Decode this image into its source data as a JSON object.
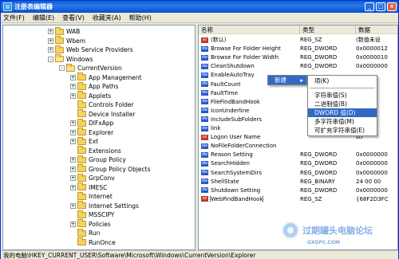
{
  "window": {
    "title": "注册表编辑器",
    "buttons": {
      "minimize": "_",
      "maximize": "□",
      "close": "×"
    }
  },
  "menu": [
    "文件(F)",
    "编辑(E)",
    "查看(V)",
    "收藏夹(A)",
    "帮助(H)"
  ],
  "tree": [
    {
      "label": "WAB",
      "expander": "+"
    },
    {
      "label": "Wbem",
      "expander": "+"
    },
    {
      "label": "Web Service Providers",
      "expander": "+"
    },
    {
      "label": "Windows",
      "expander": "-"
    },
    {
      "label": "CurrentVersion",
      "expander": "-"
    },
    {
      "label": "App Management",
      "expander": "+"
    },
    {
      "label": "App Paths",
      "expander": "+"
    },
    {
      "label": "Applets",
      "expander": "+"
    },
    {
      "label": "Controls Folder",
      "expander": ""
    },
    {
      "label": "Device Installer",
      "expander": ""
    },
    {
      "label": "DIFxApp",
      "expander": "+"
    },
    {
      "label": "Explorer",
      "expander": "+"
    },
    {
      "label": "Ext",
      "expander": "+"
    },
    {
      "label": "Extensions",
      "expander": ""
    },
    {
      "label": "Group Policy",
      "expander": "+"
    },
    {
      "label": "Group Policy Objects",
      "expander": "+"
    },
    {
      "label": "GrpConv",
      "expander": "+"
    },
    {
      "label": "IMESC",
      "expander": "+"
    },
    {
      "label": "Internet",
      "expander": ""
    },
    {
      "label": "Internet Settings",
      "expander": "+"
    },
    {
      "label": "MSSCIPY",
      "expander": ""
    },
    {
      "label": "Policies",
      "expander": "+"
    },
    {
      "label": "Run",
      "expander": ""
    },
    {
      "label": "RunOnce",
      "expander": ""
    }
  ],
  "columns": {
    "name": "名称",
    "type": "类型",
    "data": "数据"
  },
  "values": [
    {
      "icon": "sz",
      "name": "(默认)",
      "type": "REG_SZ",
      "data": "(数值未设"
    },
    {
      "icon": "dw",
      "name": "Browse For Folder Height",
      "type": "REG_DWORD",
      "data": "0x0000012"
    },
    {
      "icon": "dw",
      "name": "Browse For Folder Width",
      "type": "REG_DWORD",
      "data": "0x0000010"
    },
    {
      "icon": "dw",
      "name": "CleanShutdown",
      "type": "REG_DWORD",
      "data": "0x0000000"
    },
    {
      "icon": "dw",
      "name": "EnableAutoTray",
      "type": "",
      "data": ""
    },
    {
      "icon": "dw",
      "name": "FaultCount",
      "type": "",
      "data": ""
    },
    {
      "icon": "dw",
      "name": "FaultTime",
      "type": "",
      "data": ""
    },
    {
      "icon": "dw",
      "name": "FileFindBandHook",
      "type": "",
      "data": "A18"
    },
    {
      "icon": "dw",
      "name": "IconUnderline",
      "type": "",
      "data": ""
    },
    {
      "icon": "dw",
      "name": "IncludeSubFolders",
      "type": "",
      "data": ""
    },
    {
      "icon": "dw",
      "name": "link",
      "type": "",
      "data": ""
    },
    {
      "icon": "sz",
      "name": "Logon User Name",
      "type": "",
      "data": "str"
    },
    {
      "icon": "dw",
      "name": "NoFileFolderConnection",
      "type": "",
      "data": ""
    },
    {
      "icon": "dw",
      "name": "Reason Setting",
      "type": "REG_DWORD",
      "data": "0x0000000"
    },
    {
      "icon": "dw",
      "name": "SearchHidden",
      "type": "REG_DWORD",
      "data": "0x0000000"
    },
    {
      "icon": "dw",
      "name": "SearchSystemDirs",
      "type": "REG_DWORD",
      "data": "0x0000000"
    },
    {
      "icon": "dw",
      "name": "ShellState",
      "type": "REG_BINARY",
      "data": "24 00 00"
    },
    {
      "icon": "dw",
      "name": "Shutdown Setting",
      "type": "REG_DWORD",
      "data": "0x0000000"
    },
    {
      "icon": "sz",
      "name": "WebFindBandHook",
      "type": "REG_SZ",
      "data": "{68F2D3FC"
    }
  ],
  "context_menu": {
    "new_label": "新建",
    "new_arrow": "▸",
    "submenu": [
      "项(K)",
      "字符串值(S)",
      "二进制值(B)",
      "DWORD 值(D)",
      "多字符串值(M)",
      "可扩充字符串值(E)"
    ],
    "highlighted_index": 3
  },
  "status": "我的电脑\\HKEY_CURRENT_USER\\Software\\Microsoft\\Windows\\CurrentVersion\\Explorer",
  "watermark": {
    "text": "过期罐头电脑论坛",
    "sub": "GXGPC.COM"
  }
}
